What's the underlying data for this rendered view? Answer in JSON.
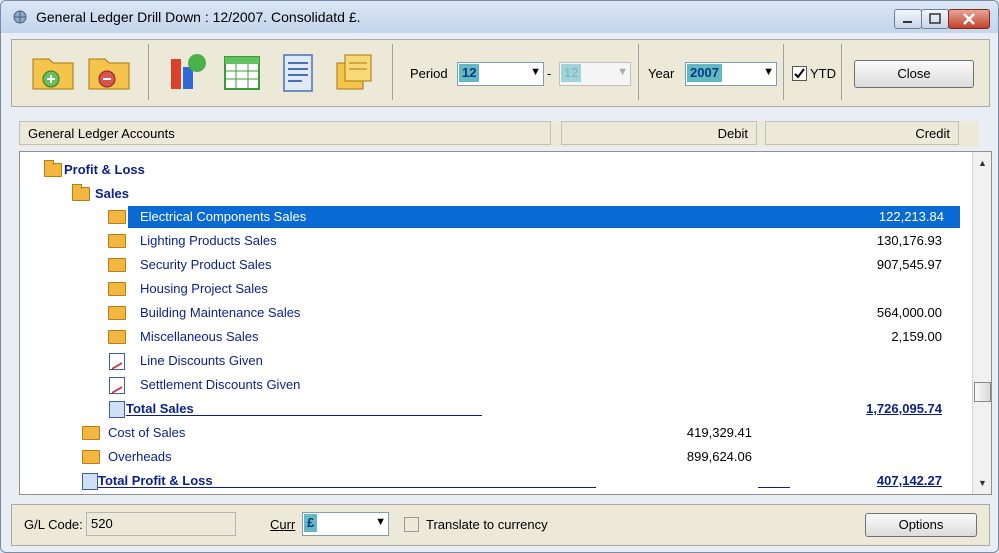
{
  "window": {
    "title": "General Ledger Drill Down : 12/2007. Consolidatd £."
  },
  "toolbar": {
    "period_label": "Period",
    "period_from": "12",
    "period_dash": "-",
    "period_to": "12",
    "year_label": "Year",
    "year_value": "2007",
    "ytd_label": "YTD",
    "ytd_checked": true,
    "close_label": "Close"
  },
  "columns": {
    "accounts": "General Ledger Accounts",
    "debit": "Debit",
    "credit": "Credit"
  },
  "rows": [
    {
      "label": "Profit & Loss",
      "debit": "",
      "credit": ""
    },
    {
      "label": "Sales",
      "debit": "",
      "credit": ""
    },
    {
      "label": "Electrical Components Sales",
      "debit": "",
      "credit": "122,213.84"
    },
    {
      "label": "Lighting Products Sales",
      "debit": "",
      "credit": "130,176.93"
    },
    {
      "label": "Security Product Sales",
      "debit": "",
      "credit": "907,545.97"
    },
    {
      "label": "Housing Project Sales",
      "debit": "",
      "credit": ""
    },
    {
      "label": "Building Maintenance Sales",
      "debit": "",
      "credit": "564,000.00"
    },
    {
      "label": "Miscellaneous Sales",
      "debit": "",
      "credit": "2,159.00"
    },
    {
      "label": "Line Discounts Given",
      "debit": "",
      "credit": ""
    },
    {
      "label": "Settlement Discounts Given",
      "debit": "",
      "credit": ""
    },
    {
      "label": "Total   Sales",
      "debit": "",
      "credit": "1,726,095.74"
    },
    {
      "label": "Cost of Sales",
      "debit": "419,329.41",
      "credit": ""
    },
    {
      "label": "Overheads",
      "debit": "899,624.06",
      "credit": ""
    },
    {
      "label": "Total  Profit & Loss",
      "debit": "",
      "credit": "407,142.27"
    }
  ],
  "footer": {
    "gl_code_label": "G/L Code:",
    "gl_code_value": "520",
    "curr_label": "Curr",
    "curr_value": "£",
    "translate_label": "Translate to currency",
    "options_label": "Options"
  },
  "colors": {
    "selection": "#0a6ad4",
    "account_text": "#0b1f8a",
    "field_highlight": "#66b8c0"
  }
}
